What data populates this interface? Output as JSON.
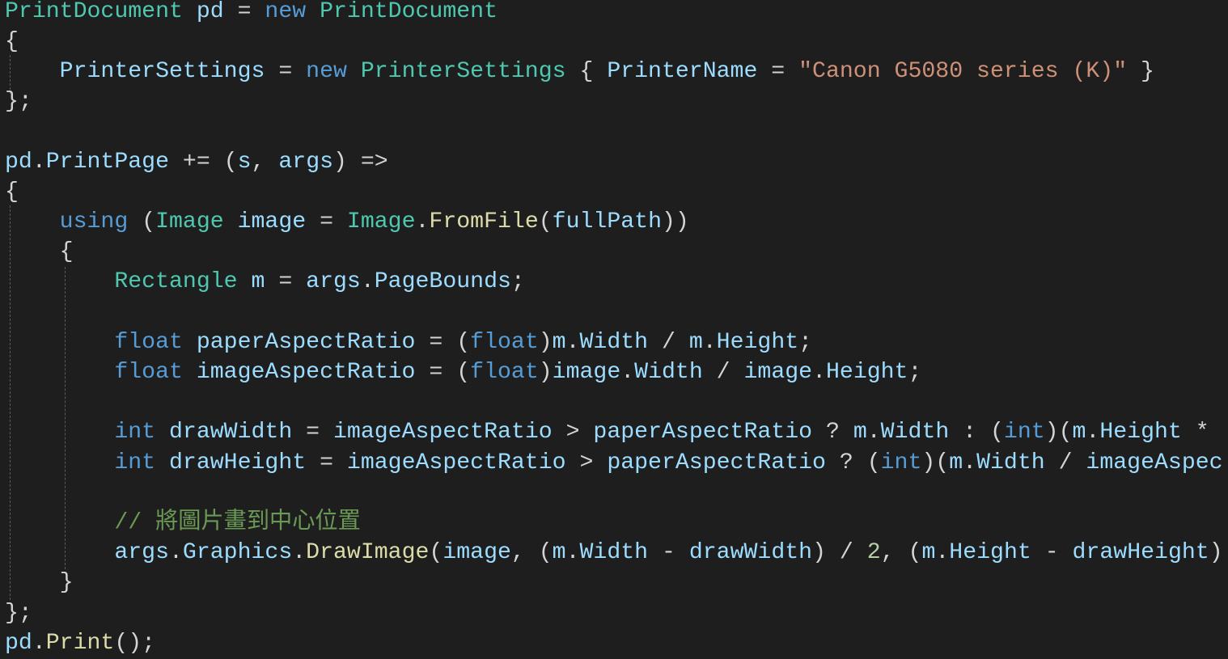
{
  "editor": {
    "language": "C#",
    "theme": "dark",
    "colors": {
      "background": "#1e1e1e",
      "plain": "#d4d4d4",
      "type": "#4ec9b0",
      "keyword": "#569cd6",
      "variable": "#9cdcfe",
      "method": "#dcdcaa",
      "string": "#ce9178",
      "number": "#b5cea8",
      "comment": "#6a9955",
      "indent_guide": "#5a5a5a"
    },
    "lines": [
      [
        [
          "type",
          "PrintDocument"
        ],
        [
          "plain",
          " "
        ],
        [
          "var",
          "pd"
        ],
        [
          "plain",
          " = "
        ],
        [
          "keyword",
          "new"
        ],
        [
          "plain",
          " "
        ],
        [
          "type",
          "PrintDocument"
        ]
      ],
      [
        [
          "plain",
          "{"
        ]
      ],
      [
        [
          "plain",
          "    "
        ],
        [
          "var",
          "PrinterSettings"
        ],
        [
          "plain",
          " = "
        ],
        [
          "keyword",
          "new"
        ],
        [
          "plain",
          " "
        ],
        [
          "type",
          "PrinterSettings"
        ],
        [
          "plain",
          " { "
        ],
        [
          "var",
          "PrinterName"
        ],
        [
          "plain",
          " = "
        ],
        [
          "string",
          "\"Canon G5080 series (K)\""
        ],
        [
          "plain",
          " }"
        ]
      ],
      [
        [
          "plain",
          "};"
        ]
      ],
      [],
      [
        [
          "var",
          "pd"
        ],
        [
          "plain",
          "."
        ],
        [
          "var",
          "PrintPage"
        ],
        [
          "plain",
          " += ("
        ],
        [
          "var",
          "s"
        ],
        [
          "plain",
          ", "
        ],
        [
          "var",
          "args"
        ],
        [
          "plain",
          ") =>"
        ]
      ],
      [
        [
          "plain",
          "{"
        ]
      ],
      [
        [
          "plain",
          "    "
        ],
        [
          "keyword",
          "using"
        ],
        [
          "plain",
          " ("
        ],
        [
          "type",
          "Image"
        ],
        [
          "plain",
          " "
        ],
        [
          "var",
          "image"
        ],
        [
          "plain",
          " = "
        ],
        [
          "type",
          "Image"
        ],
        [
          "plain",
          "."
        ],
        [
          "method",
          "FromFile"
        ],
        [
          "plain",
          "("
        ],
        [
          "var",
          "fullPath"
        ],
        [
          "plain",
          "))"
        ]
      ],
      [
        [
          "plain",
          "    {"
        ]
      ],
      [
        [
          "plain",
          "        "
        ],
        [
          "type",
          "Rectangle"
        ],
        [
          "plain",
          " "
        ],
        [
          "var",
          "m"
        ],
        [
          "plain",
          " = "
        ],
        [
          "var",
          "args"
        ],
        [
          "plain",
          "."
        ],
        [
          "var",
          "PageBounds"
        ],
        [
          "plain",
          ";"
        ]
      ],
      [],
      [
        [
          "plain",
          "        "
        ],
        [
          "keyword",
          "float"
        ],
        [
          "plain",
          " "
        ],
        [
          "var",
          "paperAspectRatio"
        ],
        [
          "plain",
          " = ("
        ],
        [
          "keyword",
          "float"
        ],
        [
          "plain",
          ")"
        ],
        [
          "var",
          "m"
        ],
        [
          "plain",
          "."
        ],
        [
          "var",
          "Width"
        ],
        [
          "plain",
          " / "
        ],
        [
          "var",
          "m"
        ],
        [
          "plain",
          "."
        ],
        [
          "var",
          "Height"
        ],
        [
          "plain",
          ";"
        ]
      ],
      [
        [
          "plain",
          "        "
        ],
        [
          "keyword",
          "float"
        ],
        [
          "plain",
          " "
        ],
        [
          "var",
          "imageAspectRatio"
        ],
        [
          "plain",
          " = ("
        ],
        [
          "keyword",
          "float"
        ],
        [
          "plain",
          ")"
        ],
        [
          "var",
          "image"
        ],
        [
          "plain",
          "."
        ],
        [
          "var",
          "Width"
        ],
        [
          "plain",
          " / "
        ],
        [
          "var",
          "image"
        ],
        [
          "plain",
          "."
        ],
        [
          "var",
          "Height"
        ],
        [
          "plain",
          ";"
        ]
      ],
      [],
      [
        [
          "plain",
          "        "
        ],
        [
          "keyword",
          "int"
        ],
        [
          "plain",
          " "
        ],
        [
          "var",
          "drawWidth"
        ],
        [
          "plain",
          " = "
        ],
        [
          "var",
          "imageAspectRatio"
        ],
        [
          "plain",
          " > "
        ],
        [
          "var",
          "paperAspectRatio"
        ],
        [
          "plain",
          " ? "
        ],
        [
          "var",
          "m"
        ],
        [
          "plain",
          "."
        ],
        [
          "var",
          "Width"
        ],
        [
          "plain",
          " : ("
        ],
        [
          "keyword",
          "int"
        ],
        [
          "plain",
          ")("
        ],
        [
          "var",
          "m"
        ],
        [
          "plain",
          "."
        ],
        [
          "var",
          "Height"
        ],
        [
          "plain",
          " *"
        ]
      ],
      [
        [
          "plain",
          "        "
        ],
        [
          "keyword",
          "int"
        ],
        [
          "plain",
          " "
        ],
        [
          "var",
          "drawHeight"
        ],
        [
          "plain",
          " = "
        ],
        [
          "var",
          "imageAspectRatio"
        ],
        [
          "plain",
          " > "
        ],
        [
          "var",
          "paperAspectRatio"
        ],
        [
          "plain",
          " ? ("
        ],
        [
          "keyword",
          "int"
        ],
        [
          "plain",
          ")("
        ],
        [
          "var",
          "m"
        ],
        [
          "plain",
          "."
        ],
        [
          "var",
          "Width"
        ],
        [
          "plain",
          " / "
        ],
        [
          "var",
          "imageAspec"
        ]
      ],
      [],
      [
        [
          "plain",
          "        "
        ],
        [
          "comment",
          "// 將圖片畫到中心位置"
        ]
      ],
      [
        [
          "plain",
          "        "
        ],
        [
          "var",
          "args"
        ],
        [
          "plain",
          "."
        ],
        [
          "var",
          "Graphics"
        ],
        [
          "plain",
          "."
        ],
        [
          "method",
          "DrawImage"
        ],
        [
          "plain",
          "("
        ],
        [
          "var",
          "image"
        ],
        [
          "plain",
          ", ("
        ],
        [
          "var",
          "m"
        ],
        [
          "plain",
          "."
        ],
        [
          "var",
          "Width"
        ],
        [
          "plain",
          " - "
        ],
        [
          "var",
          "drawWidth"
        ],
        [
          "plain",
          ") / "
        ],
        [
          "number",
          "2"
        ],
        [
          "plain",
          ", ("
        ],
        [
          "var",
          "m"
        ],
        [
          "plain",
          "."
        ],
        [
          "var",
          "Height"
        ],
        [
          "plain",
          " - "
        ],
        [
          "var",
          "drawHeight"
        ],
        [
          "plain",
          ")"
        ]
      ],
      [
        [
          "plain",
          "    }"
        ]
      ],
      [
        [
          "plain",
          "};"
        ]
      ],
      [
        [
          "var",
          "pd"
        ],
        [
          "plain",
          "."
        ],
        [
          "method",
          "Print"
        ],
        [
          "plain",
          "();"
        ]
      ]
    ]
  }
}
